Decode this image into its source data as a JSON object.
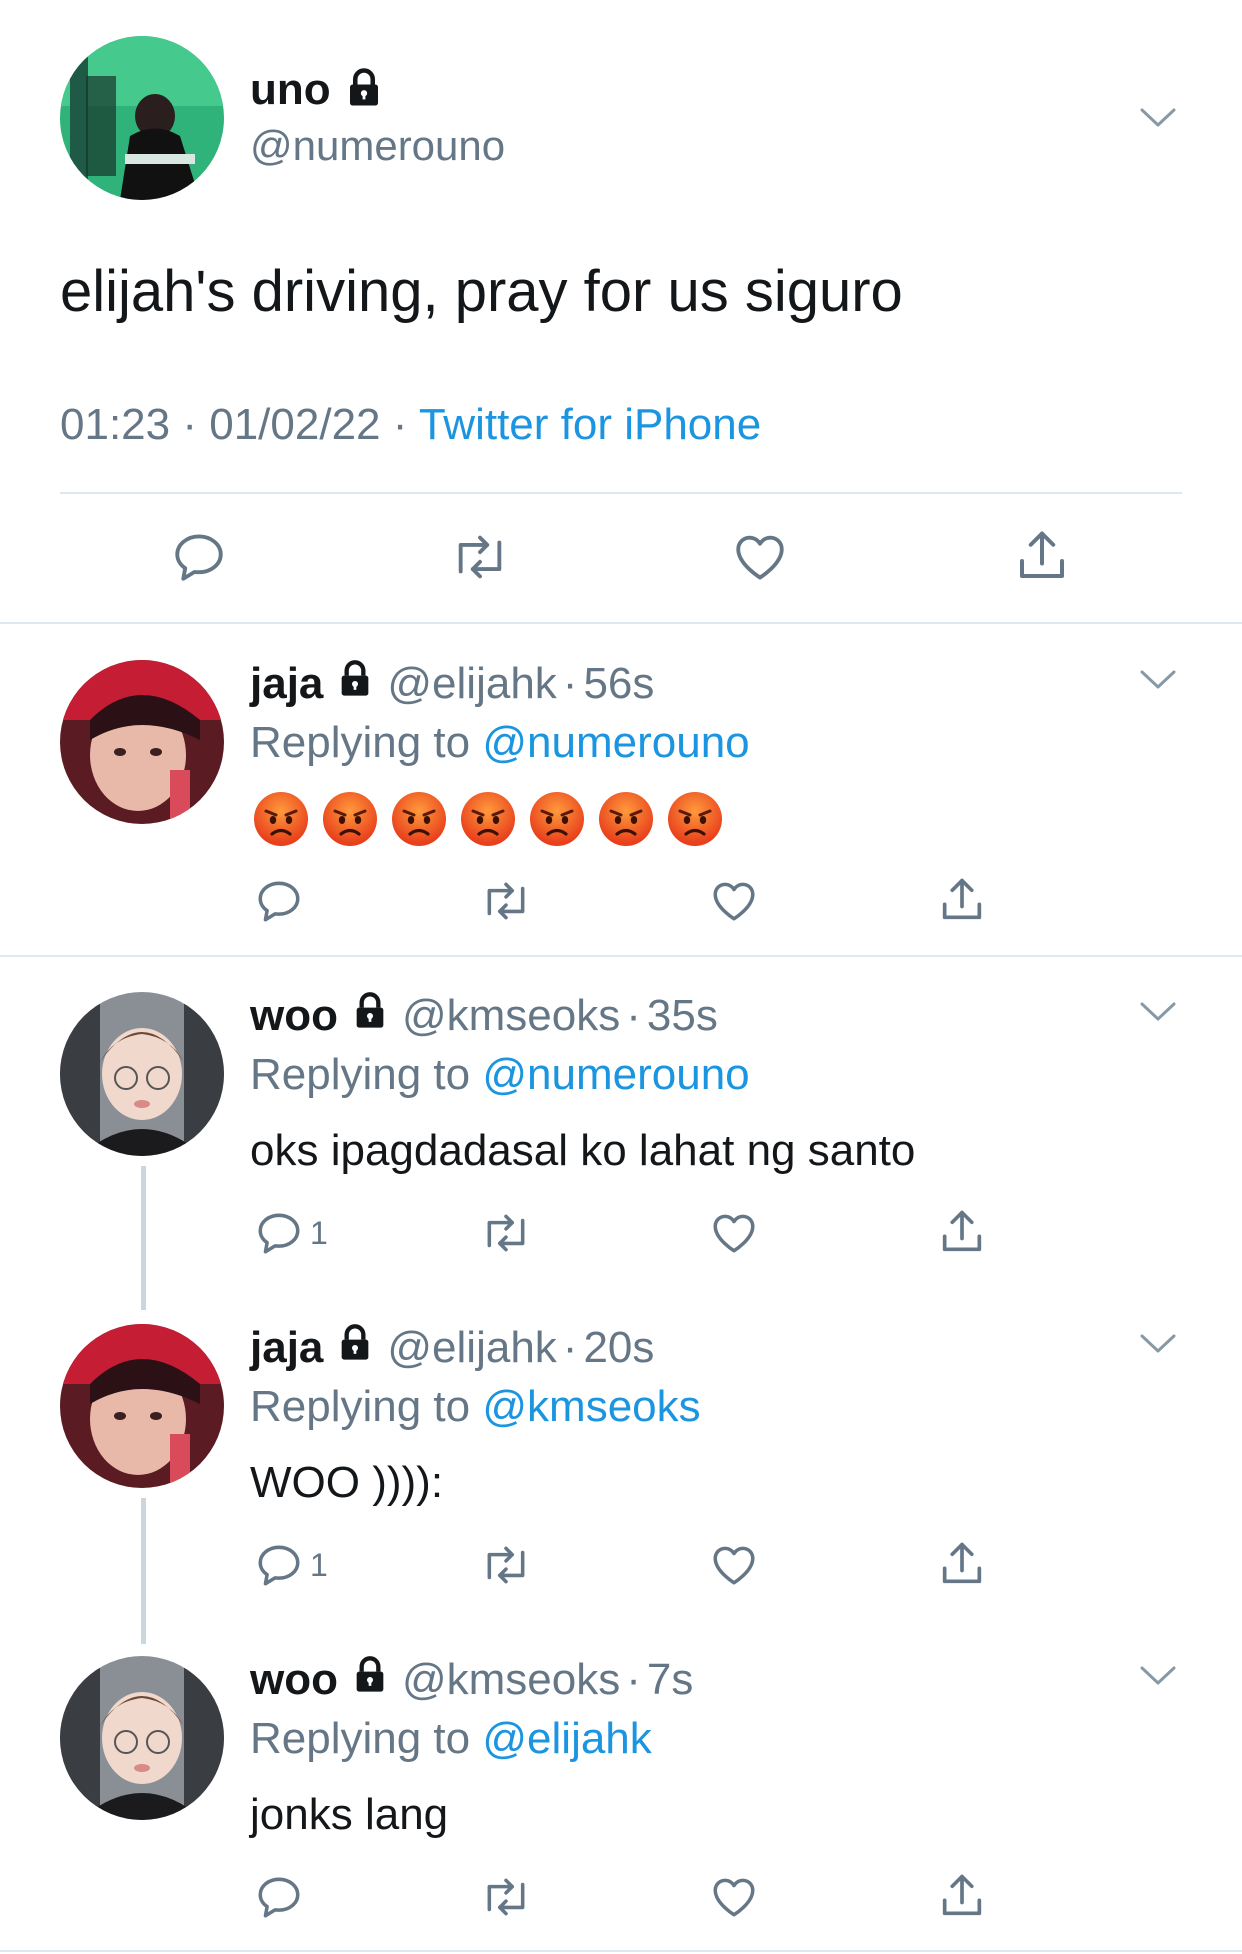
{
  "main_tweet": {
    "name": "uno",
    "handle": "@numerouno",
    "text": "elijah's driving, pray for us siguro",
    "time": "01:23",
    "date": "01/02/22",
    "dot": "·",
    "client": "Twitter for iPhone"
  },
  "replies": [
    {
      "name": "jaja",
      "handle": "@elijahk",
      "dot": "·",
      "age": "56s",
      "replying_prefix": "Replying to",
      "replying_to": "@numerouno",
      "emoji_count": 7,
      "emoji": "pouting-face",
      "text": "",
      "reply_count": ""
    },
    {
      "name": "woo",
      "handle": "@kmseoks",
      "dot": "·",
      "age": "35s",
      "replying_prefix": "Replying to",
      "replying_to": "@numerouno",
      "text": "oks ipagdadasal ko lahat ng santo",
      "reply_count": "1"
    },
    {
      "name": "jaja",
      "handle": "@elijahk",
      "dot": "·",
      "age": "20s",
      "replying_prefix": "Replying to",
      "replying_to": "@kmseoks",
      "text": "WOO )))):",
      "reply_count": "1"
    },
    {
      "name": "woo",
      "handle": "@kmseoks",
      "dot": "·",
      "age": "7s",
      "replying_prefix": "Replying to",
      "replying_to": "@elijahk",
      "text": "jonks lang",
      "reply_count": ""
    }
  ],
  "colors": {
    "link_blue": "#1b95e0",
    "secondary_gray": "#657786",
    "divider": "#e1e8ed",
    "thread_line": "#ccd6dd"
  },
  "icons": [
    "lock-icon",
    "chevron-down-icon",
    "reply-icon",
    "retweet-icon",
    "like-icon",
    "share-icon"
  ]
}
